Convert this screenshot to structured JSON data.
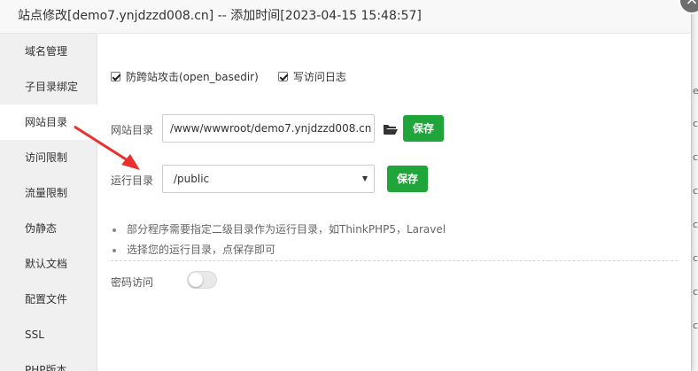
{
  "dialog": {
    "title": "站点修改[demo7.ynjdzzd008.cn] -- 添加时间[2023-04-15 15:48:57]",
    "close_label": "×"
  },
  "background": {
    "fragments": [
      "e",
      "c",
      "c",
      "c",
      "c",
      "c",
      "c",
      "c"
    ]
  },
  "sidebar": {
    "items": [
      {
        "label": "域名管理"
      },
      {
        "label": "子目录绑定"
      },
      {
        "label": "网站目录",
        "active": true
      },
      {
        "label": "访问限制"
      },
      {
        "label": "流量限制"
      },
      {
        "label": "伪静态"
      },
      {
        "label": "默认文档"
      },
      {
        "label": "配置文件"
      },
      {
        "label": "SSL"
      },
      {
        "label": "PHP版本"
      }
    ]
  },
  "content": {
    "checkboxes": [
      {
        "label": "防跨站攻击(open_basedir)",
        "checked": true
      },
      {
        "label": "写访问日志",
        "checked": true
      }
    ],
    "site_dir": {
      "label": "网站目录",
      "value": "/www/wwwroot/demo7.ynjdzzd008.cn",
      "save_label": "保存"
    },
    "run_dir": {
      "label": "运行目录",
      "value": "/public",
      "save_label": "保存"
    },
    "tips": [
      "部分程序需要指定二级目录作为运行目录，如ThinkPHP5，Laravel",
      "选择您的运行目录，点保存即可"
    ],
    "password_access": {
      "label": "密码访问",
      "enabled": false
    }
  },
  "colors": {
    "accent_green": "#20a53a",
    "annotation_red": "#e8322f"
  }
}
